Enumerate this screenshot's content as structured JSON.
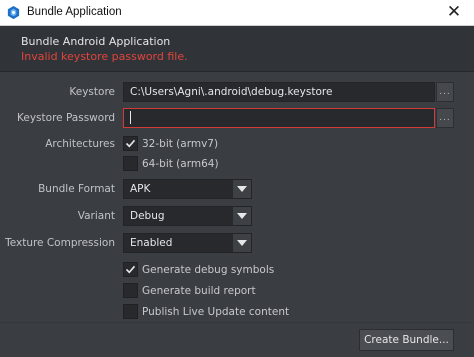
{
  "window": {
    "title": "Bundle Application",
    "close_glyph": "✕",
    "icon": "defold-logo-icon"
  },
  "header": {
    "title": "Bundle Android Application",
    "error": "Invalid keystore password file."
  },
  "form": {
    "keystore": {
      "label": "Keystore",
      "value": "C:\\Users\\Agni\\.android\\debug.keystore",
      "browse": "..."
    },
    "keystore_password": {
      "label": "Keystore Password",
      "value": "",
      "browse": "..."
    },
    "architectures": {
      "label": "Architectures",
      "options": [
        {
          "label": "32-bit (armv7)",
          "checked": true
        },
        {
          "label": "64-bit (arm64)",
          "checked": false
        }
      ]
    },
    "bundle_format": {
      "label": "Bundle Format",
      "value": "APK"
    },
    "variant": {
      "label": "Variant",
      "value": "Debug"
    },
    "texture_compression": {
      "label": "Texture Compression",
      "value": "Enabled"
    },
    "options": [
      {
        "label": "Generate debug symbols",
        "checked": true
      },
      {
        "label": "Generate build report",
        "checked": false
      },
      {
        "label": "Publish Live Update content",
        "checked": false
      }
    ]
  },
  "footer": {
    "create_button": "Create Bundle..."
  },
  "colors": {
    "background": "#3a3d42",
    "header": "#303337",
    "error": "#e2453c",
    "error_border": "#d43a36"
  }
}
